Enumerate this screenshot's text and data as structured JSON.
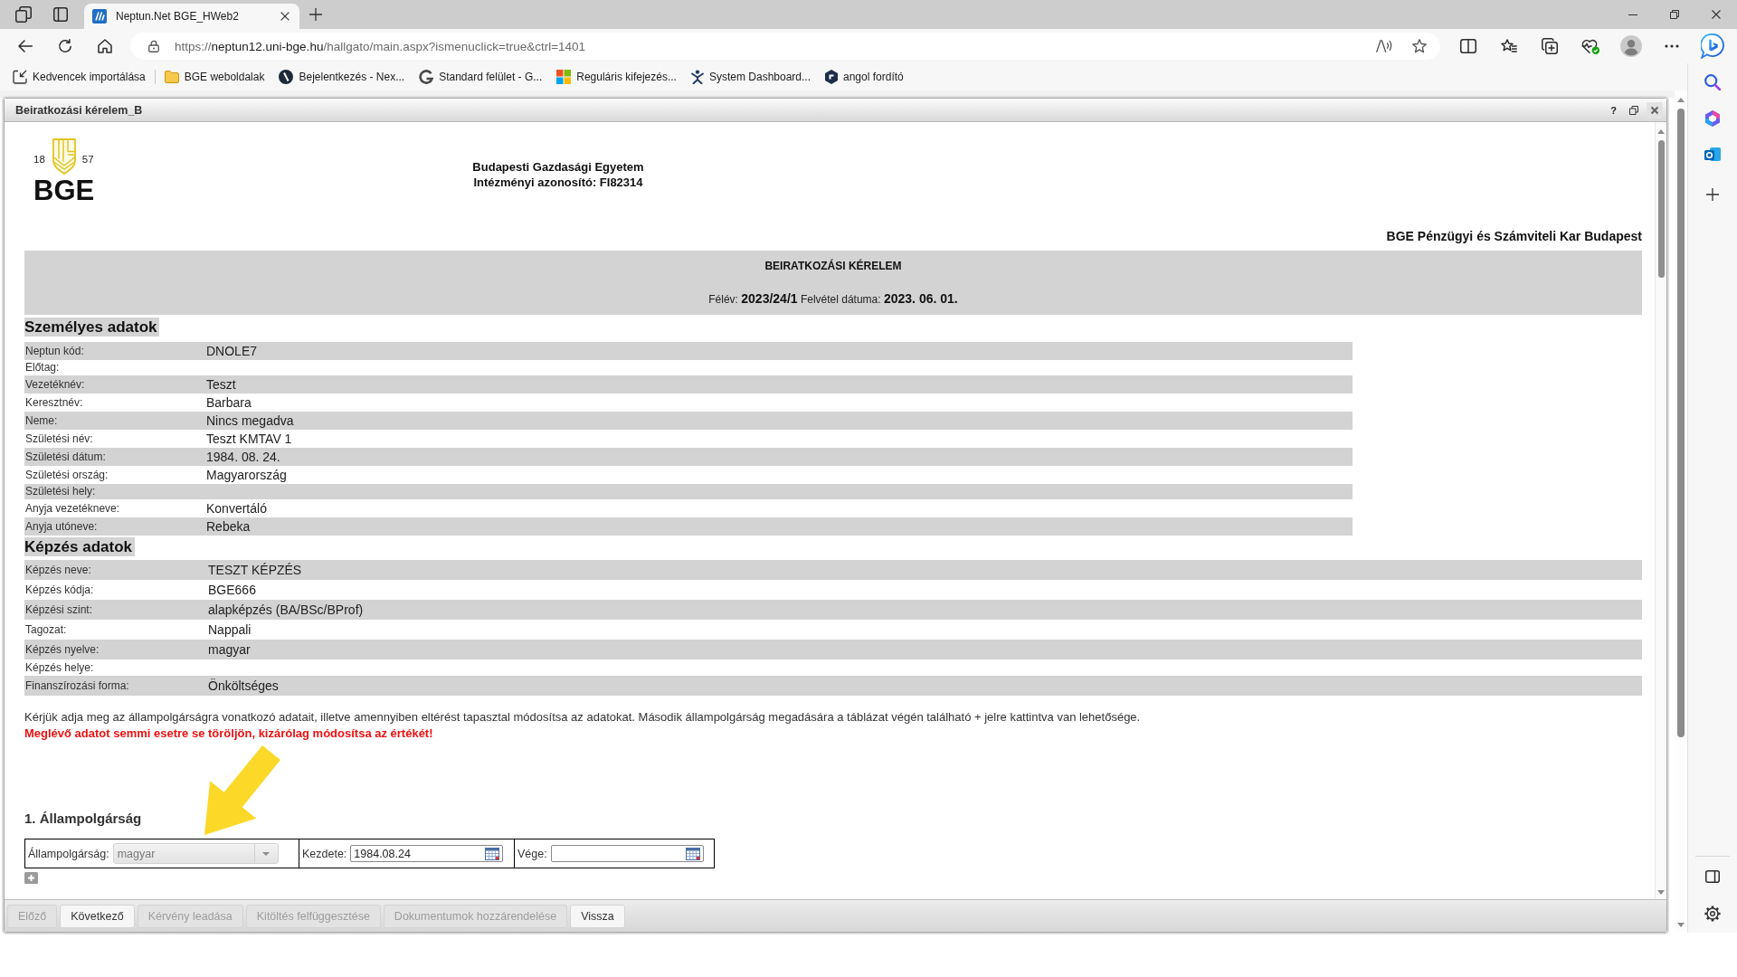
{
  "browser": {
    "tabs": [
      {
        "title": "Neptun.Net BGE_HWeb2",
        "selected": true
      }
    ],
    "address_bar": {
      "scheme": "https://",
      "host": "neptun12.uni-bge.hu",
      "path": "/hallgato/main.aspx?ismenuclick=true&ctrl=1401"
    },
    "bookmarks": [
      {
        "label": "Kedvencek importálása"
      },
      {
        "label": "BGE weboldalak"
      },
      {
        "label": "Bejelentkezés - Nex..."
      },
      {
        "label": "Standard felület - G..."
      },
      {
        "label": "Reguláris kifejezés..."
      },
      {
        "label": "System Dashboard..."
      },
      {
        "label": "angol fordító"
      }
    ]
  },
  "dialog": {
    "title": "Beiratkozási kérelem_B",
    "help": "?",
    "logo": {
      "years": [
        "18",
        "57"
      ],
      "name": "BGE"
    },
    "institution": [
      "Budapesti Gazdasági Egyetem",
      "Intézményi azonosító: FI82314"
    ],
    "faculty": "BGE Pénzügyi és Számviteli Kar Budapest",
    "form_title": "BEIRATKOZÁSI KÉRELEM",
    "term_line": "Félév: **2023/24/1** Felvétel dátuma: **2023. 06. 01.**",
    "personal_data": {
      "title": "Személyes adatok",
      "rows": [
        {
          "label": "Neptun kód:",
          "value": "DNOLE7"
        },
        {
          "label": "Előtag:"
        },
        {
          "label": "Vezetéknév:",
          "value": "Teszt"
        },
        {
          "label": "Keresztnév:",
          "value": "Barbara"
        },
        {
          "label": "Neme:",
          "value": "Nincs megadva"
        },
        {
          "label": "Születési név:",
          "value": "Teszt KMTAV 1"
        },
        {
          "label": "Születési dátum:",
          "value": "1984. 08. 24."
        },
        {
          "label": "Születési ország:",
          "value": "Magyarország"
        },
        {
          "label": "Születési hely:"
        },
        {
          "label": "Anyja vezetékneve:",
          "value": "Konvertáló"
        },
        {
          "label": "Anyja utóneve:",
          "value": "Rebeka"
        }
      ]
    },
    "training_data": {
      "title": "Képzés adatok",
      "rows": [
        {
          "label": "Képzés neve:",
          "value": "TESZT KÉPZÉS"
        },
        {
          "label": "Képzés kódja:",
          "value": "BGE666"
        },
        {
          "label": "Képzési szint:",
          "value": "alapképzés (BA/BSc/BProf)"
        },
        {
          "label": "Tagozat:",
          "value": "Nappali"
        },
        {
          "label": "Képzés nyelve:",
          "value": "magyar"
        },
        {
          "label": "Képzés helye:"
        },
        {
          "label": "Finanszírozási forma:",
          "value": "Önköltséges"
        }
      ]
    },
    "notice": "Kérjük adja meg az állampolgárságra vonatkozó adatait, illetve amennyiben eltérést tapasztal módosítsa az adatokat. Második állampolgárság megadására a táblázat végén található + jelre kattintva van lehetősége.",
    "warning": "Meglévő adatot semmi esetre se töröljön, kizárólag módosítsa az értékét!",
    "citizenship": {
      "title": "1. Állampolgárság",
      "fields": [
        {
          "kind": "select",
          "label": "Állampolgárság:",
          "value": "magyar"
        },
        {
          "kind": "date",
          "label": "Kezdete:",
          "value": "1984.08.24"
        },
        {
          "kind": "date",
          "label": "Vége:"
        }
      ]
    },
    "buttons": [
      {
        "label": "Előző",
        "disabled": true
      },
      {
        "label": "Következő",
        "disabled": false
      },
      {
        "label": "Kérvény leadása",
        "disabled": true
      },
      {
        "label": "Kitöltés felfüggesztése",
        "disabled": true
      },
      {
        "label": "Dokumentumok hozzárendelése",
        "disabled": true
      },
      {
        "label": "Vissza",
        "disabled": false
      }
    ]
  }
}
